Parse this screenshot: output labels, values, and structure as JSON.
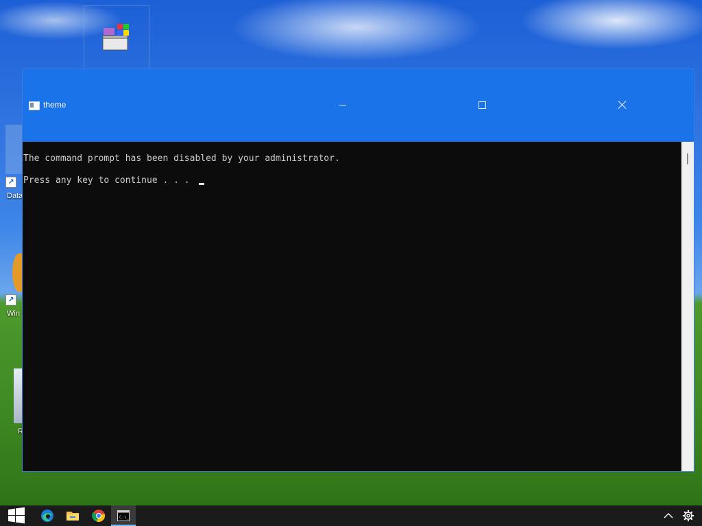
{
  "window": {
    "title": "theme",
    "minimize_label": "Minimize",
    "maximize_label": "Maximize",
    "close_label": "Close"
  },
  "console": {
    "lines": [
      "The command prompt has been disabled by your administrator.",
      "Press any key to continue . . . "
    ]
  },
  "desktop": {
    "icons": [
      {
        "name": "windows-installer-icon",
        "label": ""
      },
      {
        "name": "data-shortcut",
        "label": "Data"
      },
      {
        "name": "win-shortcut",
        "label": "Win"
      },
      {
        "name": "recycle-bin",
        "label": "R"
      }
    ]
  },
  "taskbar": {
    "items": [
      {
        "name": "start-button",
        "icon": "windows-logo-icon"
      },
      {
        "name": "edge",
        "icon": "edge-icon"
      },
      {
        "name": "file-explorer",
        "icon": "folder-icon"
      },
      {
        "name": "chrome",
        "icon": "chrome-icon"
      },
      {
        "name": "command-prompt",
        "icon": "cmd-icon",
        "active": true
      }
    ],
    "tray": [
      "chevron-up-icon",
      "gear-icon"
    ]
  },
  "colors": {
    "titlebar": "#1a73e8",
    "console_bg": "#0c0c0c",
    "console_text": "#cccccc",
    "taskbar_bg": "#1b1b1b"
  }
}
